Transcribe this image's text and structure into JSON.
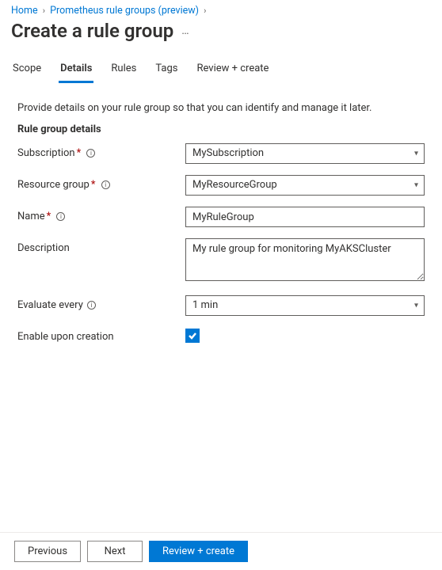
{
  "breadcrumb": {
    "home": "Home",
    "parent": "Prometheus rule groups (preview)"
  },
  "header": {
    "title": "Create a rule group"
  },
  "tabs": {
    "scope": "Scope",
    "details": "Details",
    "rules": "Rules",
    "tags": "Tags",
    "review": "Review + create"
  },
  "form": {
    "intro": "Provide details on your rule group so that you can identify and manage it later.",
    "section_title": "Rule group details",
    "subscription": {
      "label": "Subscription",
      "value": "MySubscription"
    },
    "resource_group": {
      "label": "Resource group",
      "value": "MyResourceGroup"
    },
    "name": {
      "label": "Name",
      "value": "MyRuleGroup"
    },
    "description": {
      "label": "Description",
      "value": "My rule group for monitoring MyAKSCluster"
    },
    "evaluate": {
      "label": "Evaluate every",
      "value": "1 min"
    },
    "enable": {
      "label": "Enable upon creation",
      "checked": true
    }
  },
  "footer": {
    "previous": "Previous",
    "next": "Next",
    "review": "Review + create"
  }
}
